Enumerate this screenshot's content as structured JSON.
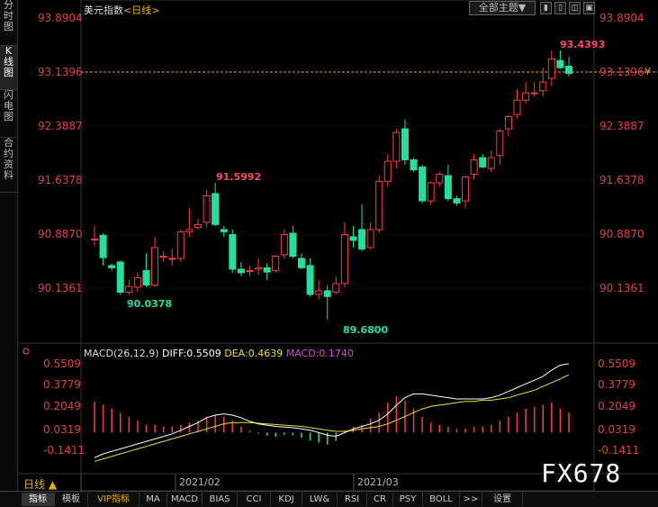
{
  "sidebar": {
    "tabs": [
      {
        "label": [
          "分",
          "时",
          "图"
        ],
        "active": false
      },
      {
        "label": [
          "K",
          "线",
          "图"
        ],
        "active": true
      },
      {
        "label": [
          "闪",
          "电",
          "图"
        ],
        "active": false
      },
      {
        "label": [
          "合",
          "约",
          "资",
          "料"
        ],
        "active": false
      }
    ]
  },
  "header": {
    "instrument": "美元指数",
    "period": "<日线>",
    "theme_button": "全部主题",
    "theme_arrow": "▼"
  },
  "price_axis": {
    "labels": [
      "93.8904",
      "93.1396",
      "92.3887",
      "91.6378",
      "90.8870",
      "90.1361"
    ],
    "current_price": "93.1396",
    "marker": "¥"
  },
  "annotations": {
    "high": "93.4393",
    "peak_feb": "91.5992",
    "low_jan": "90.0378",
    "low_feb": "89.6800"
  },
  "macd": {
    "title": "MACD(26,12,9)",
    "diff": "DIFF:0.5509",
    "dea": "DEA:0.4639",
    "macd": "MACD:0.1740",
    "axis_labels": [
      "0.5509",
      "0.3779",
      "0.2049",
      "0.0319",
      "-0.1411"
    ]
  },
  "x_axis": {
    "labels": [
      "2021/02",
      "2021/03"
    ]
  },
  "period_label": "日线 ▲",
  "watermark": "FX678",
  "bottom_tabs": [
    "指标",
    "模板",
    "VIP指标",
    "MA",
    "MACD",
    "BIAS",
    "CCI",
    "KDJ",
    "LW&",
    "RSI",
    "CR",
    "PSY",
    "BOLL",
    ">>",
    "设置"
  ],
  "colors": {
    "up": "#ff3c3c",
    "down": "#22e0a0",
    "current_line": "#ff9933",
    "diff": "#ffffff",
    "dea": "#f0e030",
    "macd": "#e040e0"
  },
  "chart_data": [
    {
      "type": "candlestick",
      "title": "美元指数",
      "ylim": [
        89.4,
        94.0
      ],
      "candles": [
        {
          "o": 90.82,
          "h": 91.0,
          "l": 90.72,
          "c": 90.82
        },
        {
          "o": 90.87,
          "h": 90.9,
          "l": 90.45,
          "c": 90.56
        },
        {
          "o": 90.45,
          "h": 90.48,
          "l": 90.38,
          "c": 90.42
        },
        {
          "o": 90.5,
          "h": 90.52,
          "l": 90.04,
          "c": 90.08
        },
        {
          "o": 90.08,
          "h": 90.25,
          "l": 90.04,
          "c": 90.16
        },
        {
          "o": 90.15,
          "h": 90.35,
          "l": 90.08,
          "c": 90.28
        },
        {
          "o": 90.38,
          "h": 90.62,
          "l": 90.15,
          "c": 90.18
        },
        {
          "o": 90.18,
          "h": 90.85,
          "l": 90.15,
          "c": 90.7
        },
        {
          "o": 90.58,
          "h": 90.65,
          "l": 90.5,
          "c": 90.58
        },
        {
          "o": 90.55,
          "h": 90.68,
          "l": 90.45,
          "c": 90.55
        },
        {
          "o": 90.55,
          "h": 90.95,
          "l": 90.5,
          "c": 90.92
        },
        {
          "o": 90.92,
          "h": 91.25,
          "l": 90.85,
          "c": 90.95
        },
        {
          "o": 90.98,
          "h": 91.1,
          "l": 90.95,
          "c": 91.02
        },
        {
          "o": 91.05,
          "h": 91.5,
          "l": 90.98,
          "c": 91.42
        },
        {
          "o": 91.45,
          "h": 91.6,
          "l": 91.0,
          "c": 91.02
        },
        {
          "o": 90.95,
          "h": 91.0,
          "l": 90.85,
          "c": 90.92
        },
        {
          "o": 90.88,
          "h": 90.95,
          "l": 90.35,
          "c": 90.4
        },
        {
          "o": 90.4,
          "h": 90.5,
          "l": 90.3,
          "c": 90.35
        },
        {
          "o": 90.38,
          "h": 90.45,
          "l": 90.3,
          "c": 90.38
        },
        {
          "o": 90.4,
          "h": 90.55,
          "l": 90.32,
          "c": 90.42
        },
        {
          "o": 90.42,
          "h": 90.48,
          "l": 90.25,
          "c": 90.36
        },
        {
          "o": 90.38,
          "h": 90.6,
          "l": 90.35,
          "c": 90.58
        },
        {
          "o": 90.6,
          "h": 90.95,
          "l": 90.55,
          "c": 90.88
        },
        {
          "o": 90.9,
          "h": 91.0,
          "l": 90.55,
          "c": 90.58
        },
        {
          "o": 90.55,
          "h": 90.62,
          "l": 90.4,
          "c": 90.42
        },
        {
          "o": 90.45,
          "h": 90.55,
          "l": 90.02,
          "c": 90.05
        },
        {
          "o": 90.05,
          "h": 90.25,
          "l": 89.98,
          "c": 90.1
        },
        {
          "o": 90.1,
          "h": 90.18,
          "l": 89.7,
          "c": 90.02
        },
        {
          "o": 90.08,
          "h": 90.3,
          "l": 90.05,
          "c": 90.2
        },
        {
          "o": 90.2,
          "h": 91.05,
          "l": 90.15,
          "c": 90.88
        },
        {
          "o": 90.85,
          "h": 91.0,
          "l": 90.7,
          "c": 90.8
        },
        {
          "o": 90.95,
          "h": 91.3,
          "l": 90.65,
          "c": 90.68
        },
        {
          "o": 90.7,
          "h": 91.05,
          "l": 90.68,
          "c": 90.95
        },
        {
          "o": 90.95,
          "h": 91.7,
          "l": 90.9,
          "c": 91.62
        },
        {
          "o": 91.62,
          "h": 92.0,
          "l": 91.55,
          "c": 91.9
        },
        {
          "o": 91.9,
          "h": 92.35,
          "l": 91.8,
          "c": 92.3
        },
        {
          "o": 92.35,
          "h": 92.48,
          "l": 91.85,
          "c": 91.92
        },
        {
          "o": 91.92,
          "h": 91.95,
          "l": 91.75,
          "c": 91.78
        },
        {
          "o": 91.82,
          "h": 91.85,
          "l": 91.32,
          "c": 91.35
        },
        {
          "o": 91.35,
          "h": 91.62,
          "l": 91.3,
          "c": 91.6
        },
        {
          "o": 91.6,
          "h": 91.75,
          "l": 91.55,
          "c": 91.72
        },
        {
          "o": 91.7,
          "h": 91.85,
          "l": 91.35,
          "c": 91.38
        },
        {
          "o": 91.38,
          "h": 91.42,
          "l": 91.28,
          "c": 91.32
        },
        {
          "o": 91.35,
          "h": 91.7,
          "l": 91.25,
          "c": 91.68
        },
        {
          "o": 91.72,
          "h": 92.0,
          "l": 91.65,
          "c": 91.92
        },
        {
          "o": 91.95,
          "h": 92.0,
          "l": 91.8,
          "c": 91.82
        },
        {
          "o": 91.8,
          "h": 92.05,
          "l": 91.75,
          "c": 91.95
        },
        {
          "o": 91.98,
          "h": 92.35,
          "l": 91.85,
          "c": 92.32
        },
        {
          "o": 92.35,
          "h": 92.55,
          "l": 92.25,
          "c": 92.52
        },
        {
          "o": 92.55,
          "h": 92.9,
          "l": 92.5,
          "c": 92.75
        },
        {
          "o": 92.75,
          "h": 93.0,
          "l": 92.7,
          "c": 92.85
        },
        {
          "o": 92.85,
          "h": 93.0,
          "l": 92.8,
          "c": 92.85
        },
        {
          "o": 92.88,
          "h": 93.2,
          "l": 92.8,
          "c": 93.0
        },
        {
          "o": 93.05,
          "h": 93.44,
          "l": 92.95,
          "c": 93.32
        },
        {
          "o": 93.3,
          "h": 93.44,
          "l": 93.18,
          "c": 93.2
        },
        {
          "o": 93.22,
          "h": 93.35,
          "l": 93.08,
          "c": 93.12
        }
      ]
    },
    {
      "type": "bar",
      "title": "MACD(26,12,9)",
      "ylim": [
        -0.23,
        0.6
      ],
      "series": [
        {
          "name": "MACD",
          "values": [
            0.155,
            0.14,
            0.12,
            0.1,
            0.08,
            0.06,
            0.04,
            0.04,
            0.03,
            0.03,
            0.04,
            0.05,
            0.06,
            0.08,
            0.09,
            0.08,
            0.06,
            0.03,
            0.01,
            -0.005,
            -0.015,
            -0.02,
            -0.01,
            -0.015,
            -0.025,
            -0.04,
            -0.05,
            -0.06,
            -0.04,
            0.01,
            0.03,
            0.04,
            0.07,
            0.1,
            0.15,
            0.18,
            0.16,
            0.12,
            0.08,
            0.05,
            0.04,
            0.03,
            0.02,
            0.02,
            0.03,
            0.03,
            0.04,
            0.06,
            0.08,
            0.1,
            0.12,
            0.13,
            0.14,
            0.15,
            0.12,
            0.1
          ]
        },
        {
          "name": "DIFF",
          "values": [
            -0.2,
            -0.17,
            -0.15,
            -0.13,
            -0.11,
            -0.09,
            -0.07,
            -0.05,
            -0.03,
            -0.01,
            0.02,
            0.05,
            0.08,
            0.12,
            0.14,
            0.15,
            0.14,
            0.12,
            0.09,
            0.07,
            0.06,
            0.05,
            0.045,
            0.04,
            0.03,
            0.02,
            0.0,
            -0.02,
            -0.03,
            0.0,
            0.03,
            0.05,
            0.07,
            0.1,
            0.15,
            0.22,
            0.28,
            0.31,
            0.31,
            0.3,
            0.29,
            0.28,
            0.27,
            0.27,
            0.27,
            0.27,
            0.28,
            0.3,
            0.33,
            0.36,
            0.39,
            0.42,
            0.45,
            0.5,
            0.54,
            0.5509
          ]
        },
        {
          "name": "DEA",
          "values": [
            -0.23,
            -0.21,
            -0.19,
            -0.17,
            -0.15,
            -0.13,
            -0.11,
            -0.09,
            -0.07,
            -0.05,
            -0.03,
            -0.01,
            0.01,
            0.03,
            0.05,
            0.07,
            0.08,
            0.08,
            0.08,
            0.075,
            0.07,
            0.065,
            0.06,
            0.055,
            0.05,
            0.04,
            0.03,
            0.02,
            0.01,
            0.01,
            0.02,
            0.03,
            0.04,
            0.05,
            0.07,
            0.1,
            0.13,
            0.16,
            0.19,
            0.21,
            0.22,
            0.23,
            0.24,
            0.25,
            0.25,
            0.26,
            0.26,
            0.27,
            0.28,
            0.3,
            0.32,
            0.34,
            0.37,
            0.4,
            0.43,
            0.4639
          ]
        }
      ]
    }
  ]
}
